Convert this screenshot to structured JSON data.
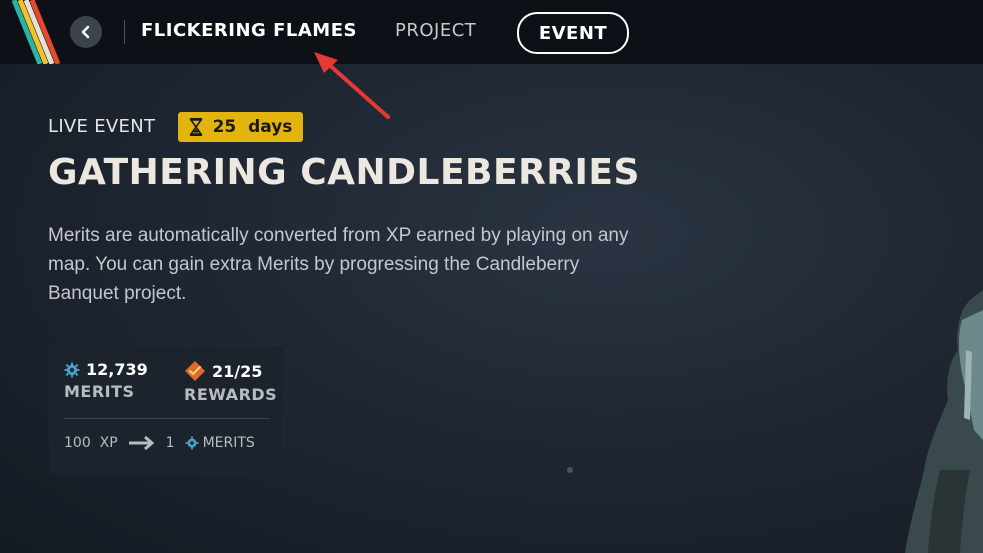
{
  "nav": {
    "active_tab": "FLICKERING FLAMES",
    "project_tab": "PROJECT",
    "event_tab": "EVENT"
  },
  "event": {
    "live_label": "LIVE EVENT",
    "timer_label": "25  days",
    "title": "GATHERING CANDLEBERRIES",
    "description": "Merits are automatically converted from XP earned by playing on any map. You can gain extra Merits by progressing the Candleberry Banquet project."
  },
  "stats": {
    "merits_value": "12,739",
    "merits_label": "MERITS",
    "rewards_value": "21/25",
    "rewards_label": "REWARDS",
    "conversion_xp": "100  XP",
    "conversion_result": "1",
    "conversion_unit": "MERITS"
  },
  "colors": {
    "timer_bg": "#e4b40e",
    "merit_icon": "#4a9fc4",
    "reward_icon": "#e06a26",
    "annotation_arrow": "#e53935"
  },
  "icons": [
    "back-arrow-icon",
    "hourglass-icon",
    "gear-merit-icon",
    "diamond-reward-icon",
    "arrow-right-icon"
  ]
}
